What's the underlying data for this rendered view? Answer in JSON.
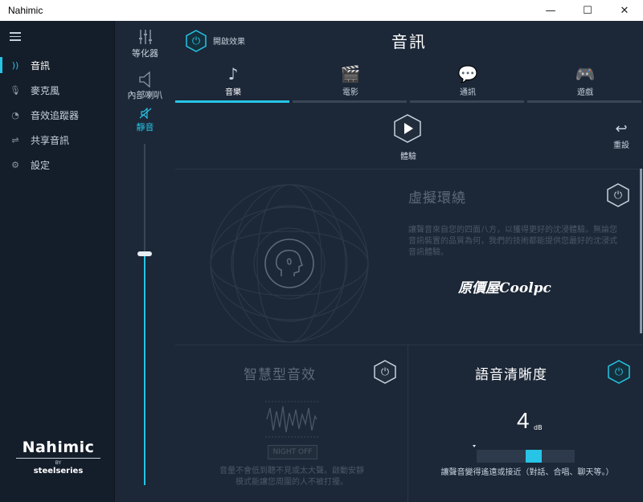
{
  "window": {
    "title": "Nahimic",
    "minimize_glyph": "—",
    "maximize_glyph": "☐",
    "close_glyph": "✕"
  },
  "sidebar": {
    "items": [
      {
        "label": "音訊",
        "icon": "speaker-wave-icon",
        "glyph": "))"
      },
      {
        "label": "麥克風",
        "icon": "microphone-icon",
        "glyph": "🎙"
      },
      {
        "label": "音效追蹤器",
        "icon": "sound-tracker-icon",
        "glyph": "◔"
      },
      {
        "label": "共享音訊",
        "icon": "share-audio-icon",
        "glyph": "⇌"
      },
      {
        "label": "設定",
        "icon": "gear-icon",
        "glyph": "⚙"
      }
    ],
    "logo": {
      "name": "Nahimic",
      "by": "BY",
      "maker": "steelseries"
    }
  },
  "volume_column": {
    "equalizer_label": "等化器",
    "device_label": "內部喇叭",
    "mute_label": "靜音",
    "volume_level": 0.68
  },
  "header": {
    "enable_effects_label": "開啟效果",
    "title": "音訊"
  },
  "tabs": [
    {
      "label": "音樂",
      "icon": "music-note-icon",
      "glyph": "♪"
    },
    {
      "label": "電影",
      "icon": "clapperboard-icon",
      "glyph": "🎬"
    },
    {
      "label": "通訊",
      "icon": "chat-bubbles-icon",
      "glyph": "💬"
    },
    {
      "label": "遊戲",
      "icon": "gamepad-icon",
      "glyph": "🎮"
    }
  ],
  "experience": {
    "play_label": "體驗",
    "reset_label": "重設",
    "reset_glyph": "↩"
  },
  "surround": {
    "title": "虛擬環繞",
    "description": "讓聲音來自您的四面八方，以獲得更好的沈浸體驗。無論您音訊裝置的品質為何，我們的技術都能提供您最好的沈浸式音訊體驗。",
    "watermark": "原價屋Coolpc"
  },
  "smart_volume": {
    "title": "智慧型音效",
    "night_label": "NIGHT OFF",
    "description": "音量不會低到聽不見或太大聲。啟動安靜模式能讓您周圍的人不被打擾。"
  },
  "voice_clarity": {
    "title": "語音清晰度",
    "value": "4",
    "unit": "dB",
    "description": "讓聲音變得遙遠或接近（對話、合唱、聊天等。）"
  },
  "colors": {
    "accent": "#27c4e6",
    "background": "#1c2737",
    "sidebar": "#141d2a"
  }
}
